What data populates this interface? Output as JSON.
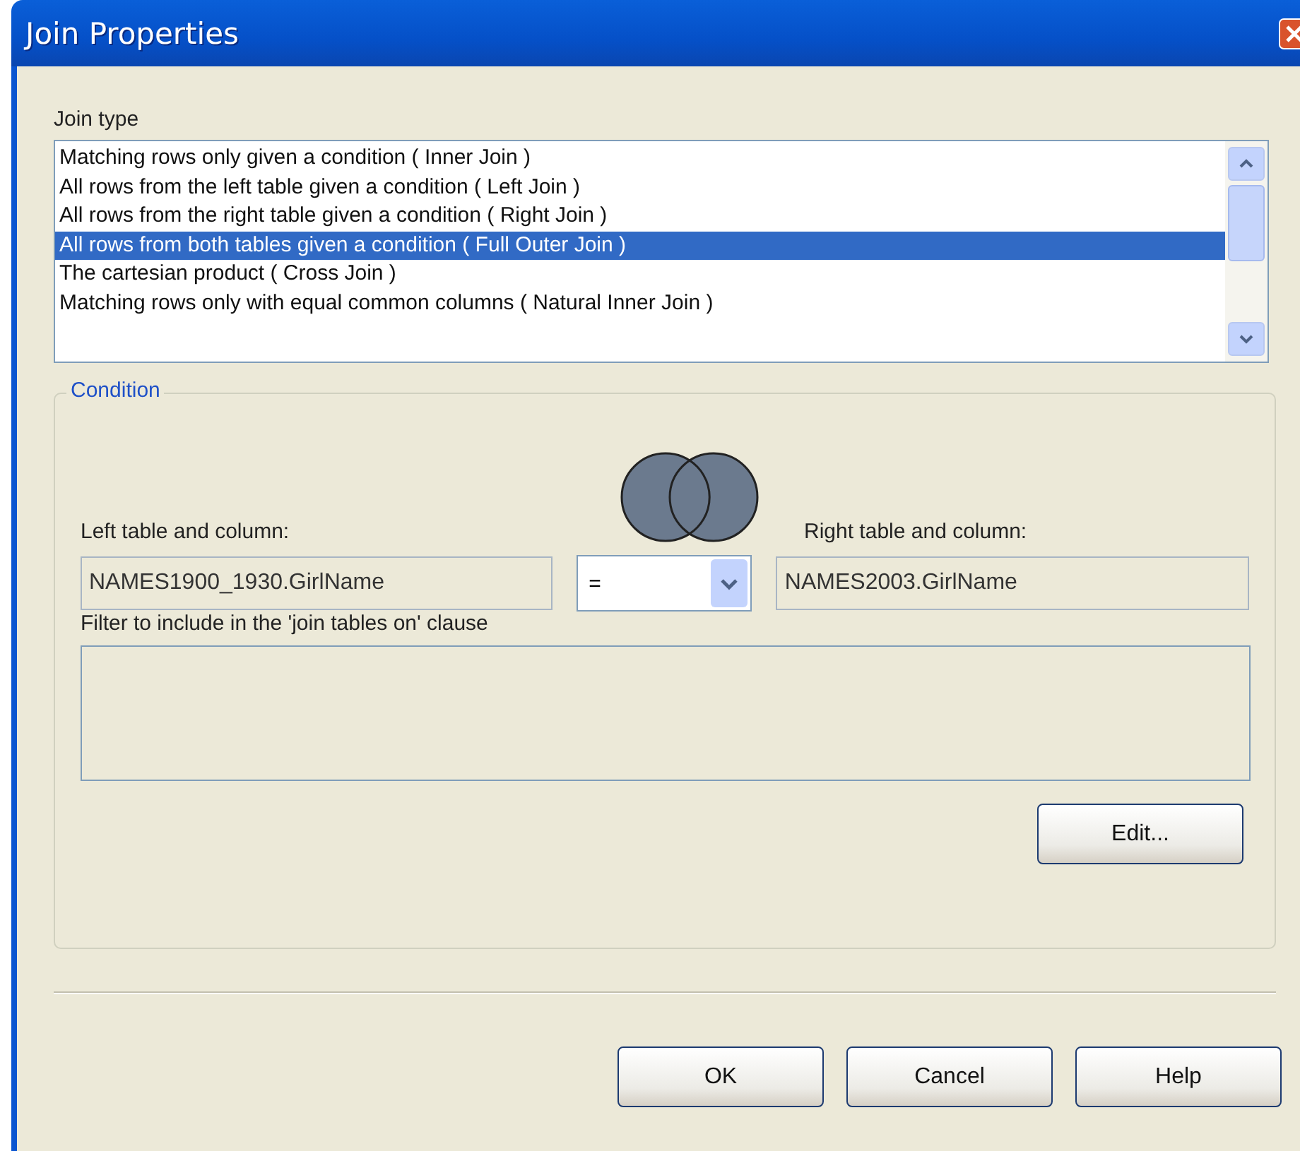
{
  "window": {
    "title": "Join Properties"
  },
  "join_type": {
    "label": "Join type",
    "options": [
      {
        "label": "Matching rows only given a condition ( Inner Join )",
        "selected": false
      },
      {
        "label": "All rows from the left table given a condition ( Left Join )",
        "selected": false
      },
      {
        "label": "All rows from the right table given a condition ( Right Join )",
        "selected": false
      },
      {
        "label": "All rows from both tables given a condition ( Full Outer Join )",
        "selected": true
      },
      {
        "label": "The cartesian product ( Cross Join )",
        "selected": false
      },
      {
        "label": "Matching rows only with equal common columns ( Natural Inner Join )",
        "selected": false
      }
    ]
  },
  "condition": {
    "title": "Condition",
    "left_label": "Left table and column:",
    "left_value": "NAMES1900_1930.GirlName",
    "operator": "=",
    "right_label": "Right table and column:",
    "right_value": "NAMES2003.GirlName",
    "filter_label": "Filter to include in the 'join tables on' clause",
    "edit_button": "Edit..."
  },
  "buttons": [
    "OK",
    "Cancel",
    "Help"
  ]
}
